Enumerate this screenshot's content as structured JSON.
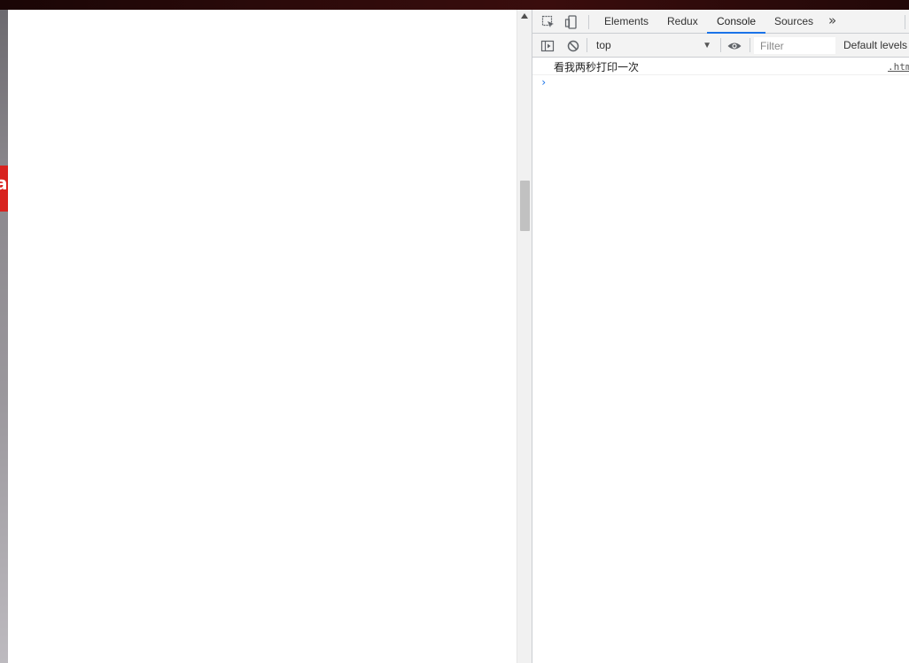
{
  "devtools": {
    "tabs": [
      {
        "label": "Elements"
      },
      {
        "label": "Redux"
      },
      {
        "label": "Console",
        "active": true
      },
      {
        "label": "Sources"
      }
    ],
    "more_tabs": "»",
    "toolbar": {
      "context": "top",
      "filter_placeholder": "Filter",
      "levels": "Default levels"
    },
    "console": {
      "messages": [
        {
          "text": "看我两秒打印一次",
          "source": ".htm"
        }
      ],
      "prompt": "›"
    }
  },
  "icons": {
    "inspect": "inspect-element-icon",
    "device": "device-toolbar-icon",
    "sidebar": "console-sidebar-icon",
    "clear": "clear-console-icon",
    "eye": "live-expression-eye-icon"
  },
  "colors": {
    "accent": "#1a73e8",
    "toolbar_bg": "#f3f3f3"
  }
}
